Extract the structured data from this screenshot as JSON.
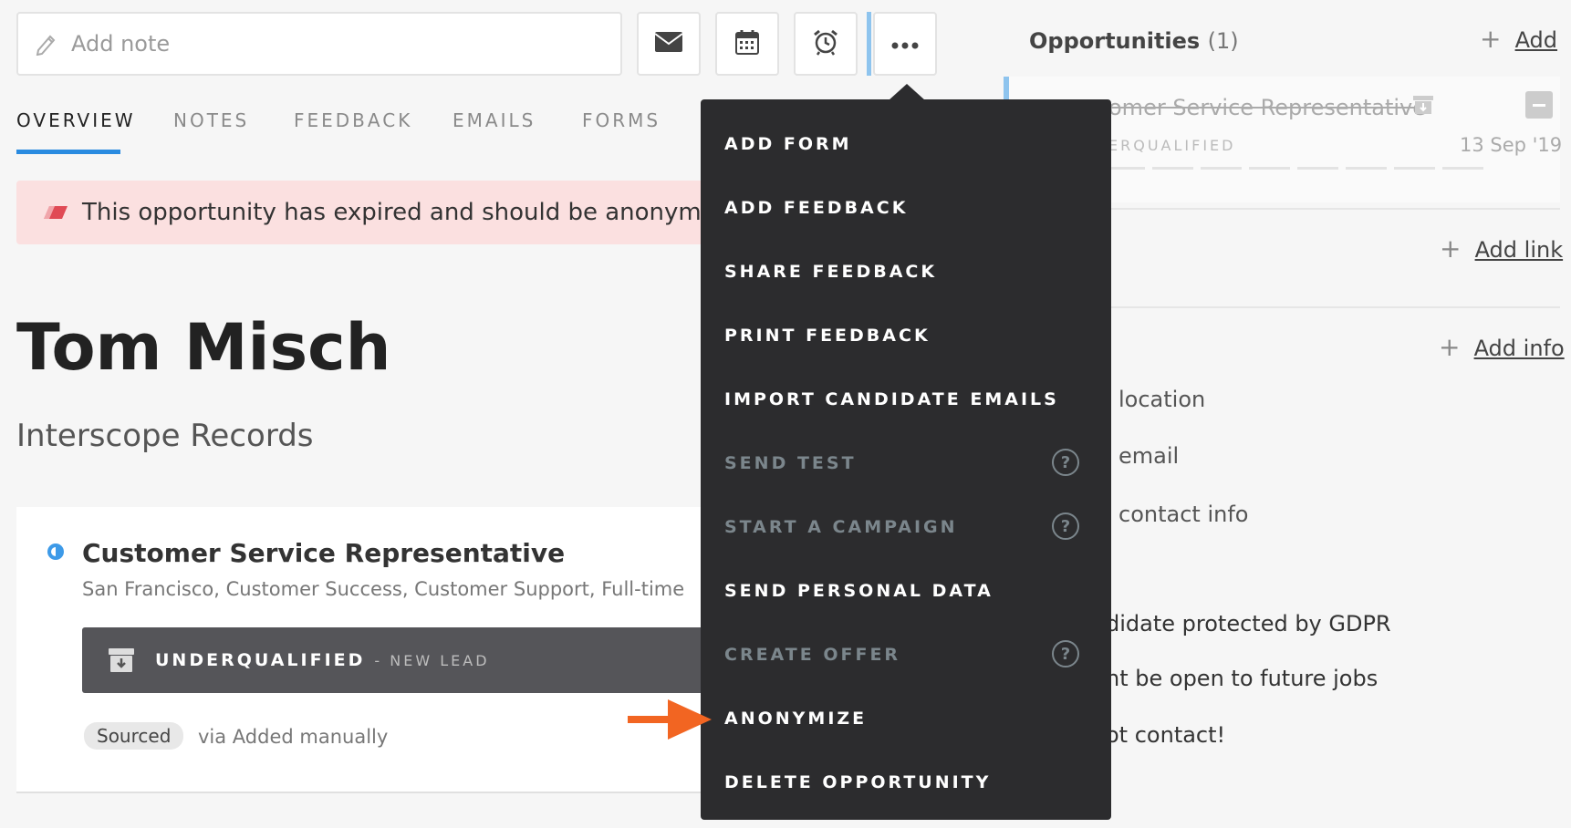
{
  "toolbar": {
    "note_placeholder": "Add note",
    "icons": [
      "pencil-icon",
      "mail-icon",
      "calendar-icon",
      "alarm-icon",
      "more-icon"
    ]
  },
  "tabs": [
    "OVERVIEW",
    "NOTES",
    "FEEDBACK",
    "EMAILS",
    "FORMS"
  ],
  "alert": {
    "text": "This opportunity has expired and should be anonymized"
  },
  "candidate": {
    "name": "Tom Misch",
    "company": "Interscope Records"
  },
  "job": {
    "title": "Customer Service Representative",
    "details": "San Francisco, Customer Success, Customer Support, Full-time",
    "stage": "UNDERQUALIFIED",
    "stage_sub": "- NEW LEAD",
    "source_badge": "Sourced",
    "source_via": "via Added manually"
  },
  "right_panel": {
    "opportunities_label": "Opportunities",
    "opportunities_count": "(1)",
    "add_label": "Add",
    "opp_name_partial": "omer Service Representative",
    "opp_stage_partial": "ERQUALIFIED",
    "opp_date": "13 Sep '19",
    "add_link_label": "Add link",
    "add_info_label": "Add info",
    "info_items": [
      "location",
      "email",
      "contact info"
    ],
    "gdpr_items": [
      "didate protected by GDPR",
      "nt be open to future jobs",
      "ot contact!"
    ]
  },
  "menu": {
    "items": [
      {
        "label": "ADD FORM",
        "disabled": false,
        "help": false
      },
      {
        "label": "ADD FEEDBACK",
        "disabled": false,
        "help": false
      },
      {
        "label": "SHARE FEEDBACK",
        "disabled": false,
        "help": false
      },
      {
        "label": "PRINT FEEDBACK",
        "disabled": false,
        "help": false
      },
      {
        "label": "IMPORT CANDIDATE EMAILS",
        "disabled": false,
        "help": false
      },
      {
        "label": "SEND TEST",
        "disabled": true,
        "help": true
      },
      {
        "label": "START A CAMPAIGN",
        "disabled": true,
        "help": true
      },
      {
        "label": "SEND PERSONAL DATA",
        "disabled": false,
        "help": false
      },
      {
        "label": "CREATE OFFER",
        "disabled": true,
        "help": true
      },
      {
        "label": "ANONYMIZE",
        "disabled": false,
        "help": false
      },
      {
        "label": "DELETE OPPORTUNITY",
        "disabled": false,
        "help": false
      }
    ],
    "help_glyph": "?"
  },
  "colors": {
    "accent_blue": "#2a8be0",
    "alert_bg": "#fbe0e0",
    "menu_bg": "#2c2c2e",
    "pointer_orange": "#f26522"
  }
}
